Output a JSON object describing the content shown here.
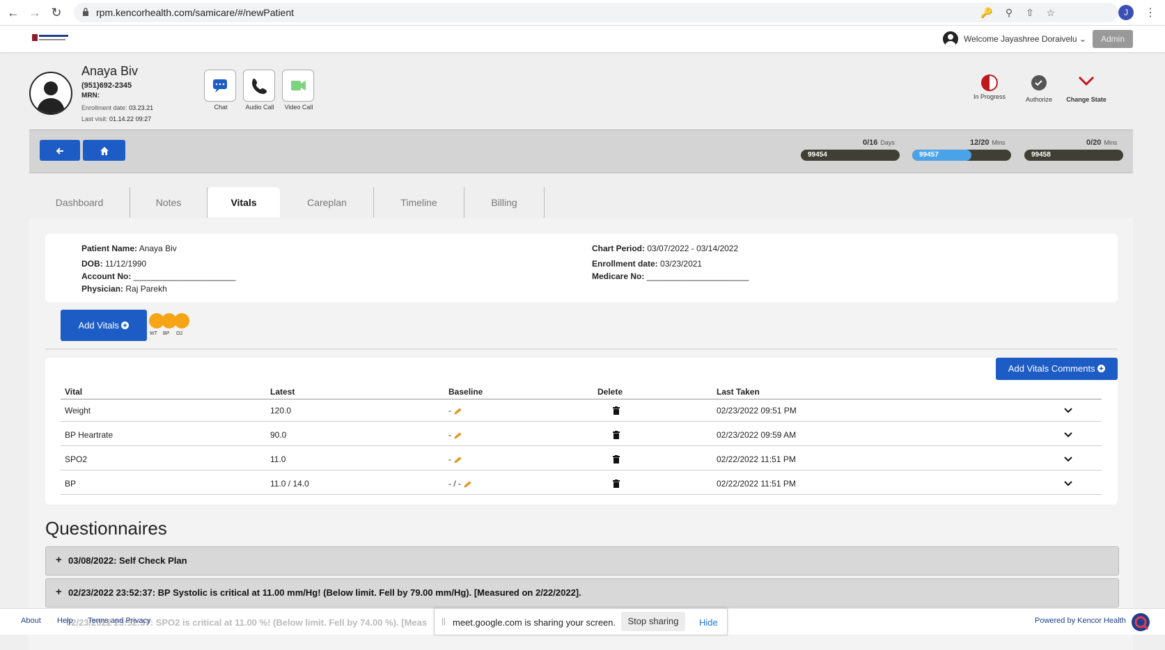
{
  "browser": {
    "url": "rpm.kencorhealth.com/samicare/#/newPatient",
    "profile_initial": "J"
  },
  "header": {
    "welcome": "Welcome Jayashree Doraivelu",
    "admin_label": "Admin"
  },
  "patient": {
    "name": "Anaya Biv",
    "phone": "(951)692-2345",
    "mrn_label": "MRN:",
    "enrollment_label": "Enrollment date:",
    "enrollment_value": "03.23.21",
    "last_visit_label": "Last visit:",
    "last_visit_value": "01.14.22 09:27"
  },
  "comm": {
    "chat": "Chat",
    "audio": "Audio Call",
    "video": "Video Call"
  },
  "states": {
    "in_progress": "In Progress",
    "authorize": "Authorize",
    "change_state": "Change State"
  },
  "cpt": [
    {
      "count": "0/16",
      "unit": "Days",
      "code": "99454",
      "progress": 0
    },
    {
      "count": "12/20",
      "unit": "Mins",
      "code": "99457",
      "progress": 0.6
    },
    {
      "count": "0/20",
      "unit": "Mins",
      "code": "99458",
      "progress": 0
    }
  ],
  "tabs": [
    "Dashboard",
    "Notes",
    "Vitals",
    "Careplan",
    "Timeline",
    "Billing"
  ],
  "active_tab": "Vitals",
  "info": {
    "patient_name_label": "Patient Name:",
    "patient_name": "Anaya Biv",
    "dob_label": "DOB:",
    "dob": "11/12/1990",
    "account_label": "Account No:",
    "account": "______________________",
    "physician_label": "Physician:",
    "physician": "Raj Parekh",
    "chart_period_label": "Chart Period:",
    "chart_period": "03/07/2022 - 03/14/2022",
    "enrollment_label": "Enrollment date:",
    "enrollment": "03/23/2021",
    "medicare_label": "Medicare No:",
    "medicare": "______________________"
  },
  "add_vitals_label": "Add Vitals",
  "vital_dots": [
    "WT",
    "BP",
    "O2"
  ],
  "vital_dot_color": "#f5a516",
  "add_vitals_comments_label": "Add Vitals Comments",
  "vitals_table": {
    "headers": [
      "Vital",
      "Latest",
      "Baseline",
      "Delete",
      "Last Taken"
    ],
    "rows": [
      {
        "vital": "Weight",
        "latest": "120.0",
        "baseline": "-",
        "last_taken": "02/23/2022 09:51 PM"
      },
      {
        "vital": "BP Heartrate",
        "latest": "90.0",
        "baseline": "-",
        "last_taken": "02/23/2022 09:59 AM"
      },
      {
        "vital": "SPO2",
        "latest": "11.0",
        "baseline": "-",
        "last_taken": "02/22/2022 11:51 PM"
      },
      {
        "vital": "BP",
        "latest": "11.0 / 14.0",
        "baseline": "- / -",
        "last_taken": "02/22/2022 11:51 PM"
      }
    ]
  },
  "questionnaires": {
    "title": "Questionnaires",
    "items": [
      "03/08/2022: Self Check Plan",
      "02/23/2022 23:52:37: BP Systolic is critical at 11.00 mm/Hg! (Below limit. Fell by 79.00 mm/Hg). [Measured on 2/22/2022]."
    ],
    "partial_item": "02/23/2022 23:52:37: SPO2 is critical at 11.00 %! (Below limit. Fell by 74.00 %). [Meas"
  },
  "footer": {
    "about": "About",
    "help": "Help",
    "terms": "Terms and Privacy",
    "powered": "Powered by Kencor Health"
  },
  "share": {
    "text": "meet.google.com is sharing your screen.",
    "stop": "Stop sharing",
    "hide": "Hide"
  },
  "colors": {
    "primary": "#1d5cc5",
    "progress_fill": "#4aa3e8",
    "progress_track": "#3f3f35",
    "change_state": "#c0171d"
  }
}
